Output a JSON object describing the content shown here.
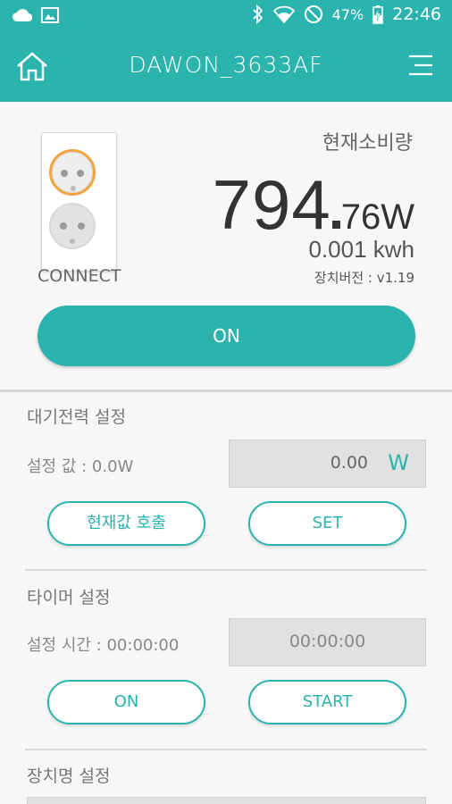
{
  "status_bar": {
    "battery": "47%",
    "time": "22:46",
    "icons": [
      "cloud-icon",
      "image-icon",
      "bluetooth-icon",
      "wifi-icon",
      "do-not-disturb-icon",
      "battery-charging-icon"
    ]
  },
  "app_bar": {
    "title": "DAWON_3633AF",
    "home_icon": "home-icon",
    "menu_icon": "menu-icon"
  },
  "device": {
    "status_label": "CONNECT",
    "consumption_label": "현재소비량",
    "power_major": "794",
    "power_minor": "76W",
    "energy": "0.001 kwh",
    "version": "장치버전 : v1.19",
    "power_button": "ON"
  },
  "standby": {
    "title": "대기전력 설정",
    "value_label": "설정 값 : 0.0W",
    "input_value": "0.00",
    "unit": "W",
    "recall_button": "현재값 호출",
    "set_button": "SET"
  },
  "timer": {
    "title": "타이머 설정",
    "time_label": "설정 시간 : 00:00:00",
    "input_value": "00:00:00",
    "on_button": "ON",
    "start_button": "START"
  },
  "device_name": {
    "title": "장치명 설정"
  },
  "colors": {
    "accent": "#2bb3ad",
    "plug_highlight": "#f0a540"
  }
}
